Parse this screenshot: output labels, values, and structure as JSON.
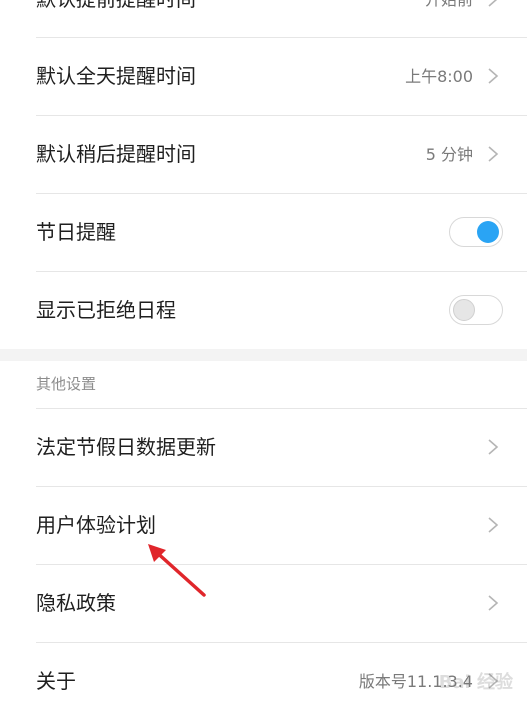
{
  "settings": {
    "rows": [
      {
        "label": "默认提前提醒时间",
        "value": "开始前"
      },
      {
        "label": "默认全天提醒时间",
        "value": "上午8:00"
      },
      {
        "label": "默认稍后提醒时间",
        "value": "5 分钟"
      },
      {
        "label": "节日提醒",
        "toggle": "on"
      },
      {
        "label": "显示已拒绝日程",
        "toggle": "off"
      }
    ]
  },
  "other": {
    "header": "其他设置",
    "rows": [
      {
        "label": "法定节假日数据更新"
      },
      {
        "label": "用户体验计划"
      },
      {
        "label": "隐私政策"
      },
      {
        "label": "关于",
        "value": "版本号11.1.3.4"
      }
    ]
  },
  "colors": {
    "accent": "#2aa4f4",
    "annotation_arrow": "#e0262b"
  },
  "watermark": "Bai 经验"
}
